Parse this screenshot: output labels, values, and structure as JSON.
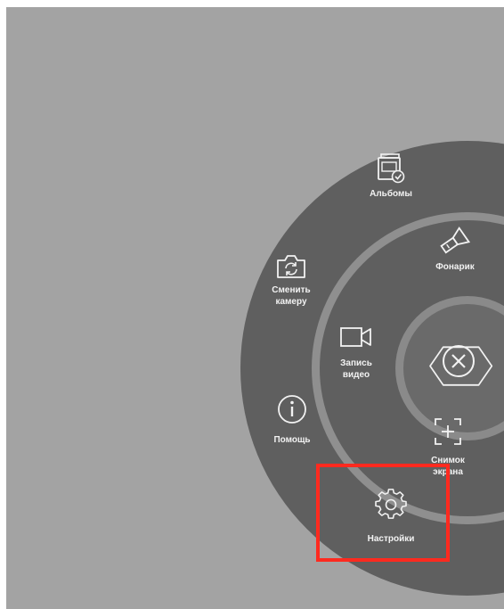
{
  "menu": {
    "albums": {
      "label": "Альбомы",
      "icon": "albums-icon"
    },
    "flashlight": {
      "label": "Фонарик",
      "icon": "flashlight-icon"
    },
    "switch_camera": {
      "label": "Сменить\nкамеру",
      "icon": "switch-camera-icon"
    },
    "record_video": {
      "label": "Запись\nвидео",
      "icon": "video-camera-icon"
    },
    "help": {
      "label": "Помощь",
      "icon": "info-icon"
    },
    "screenshot": {
      "label": "Снимок\nэкрана",
      "icon": "screenshot-icon"
    },
    "settings": {
      "label": "Настройки",
      "icon": "gear-icon"
    }
  },
  "close": {
    "icon": "close-icon"
  },
  "highlight_color": "#ff2a1f"
}
